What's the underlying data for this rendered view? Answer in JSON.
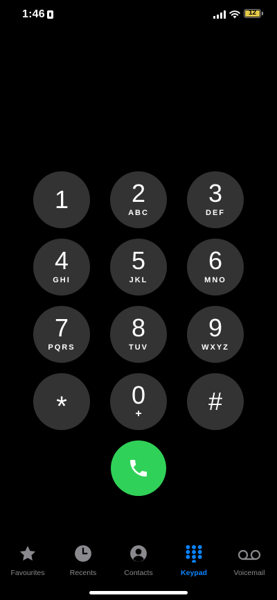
{
  "status_bar": {
    "time": "1:46",
    "battery_level": "12",
    "battery_color": "#e5c94a"
  },
  "keypad": {
    "keys": [
      {
        "digit": "1",
        "letters": ""
      },
      {
        "digit": "2",
        "letters": "ABC"
      },
      {
        "digit": "3",
        "letters": "DEF"
      },
      {
        "digit": "4",
        "letters": "GHI"
      },
      {
        "digit": "5",
        "letters": "JKL"
      },
      {
        "digit": "6",
        "letters": "MNO"
      },
      {
        "digit": "7",
        "letters": "PQRS"
      },
      {
        "digit": "8",
        "letters": "TUV"
      },
      {
        "digit": "9",
        "letters": "WXYZ"
      },
      {
        "digit": "*",
        "letters": ""
      },
      {
        "digit": "0",
        "letters": "+"
      },
      {
        "digit": "#",
        "letters": ""
      }
    ],
    "key_color": "#333333",
    "call_color": "#30d158"
  },
  "tabs": [
    {
      "label": "Favourites",
      "icon": "star-icon"
    },
    {
      "label": "Recents",
      "icon": "clock-icon"
    },
    {
      "label": "Contacts",
      "icon": "person-circle-icon"
    },
    {
      "label": "Keypad",
      "icon": "keypad-grid-icon",
      "active": true
    },
    {
      "label": "Voicemail",
      "icon": "voicemail-icon"
    }
  ],
  "accent_color": "#0a84ff"
}
